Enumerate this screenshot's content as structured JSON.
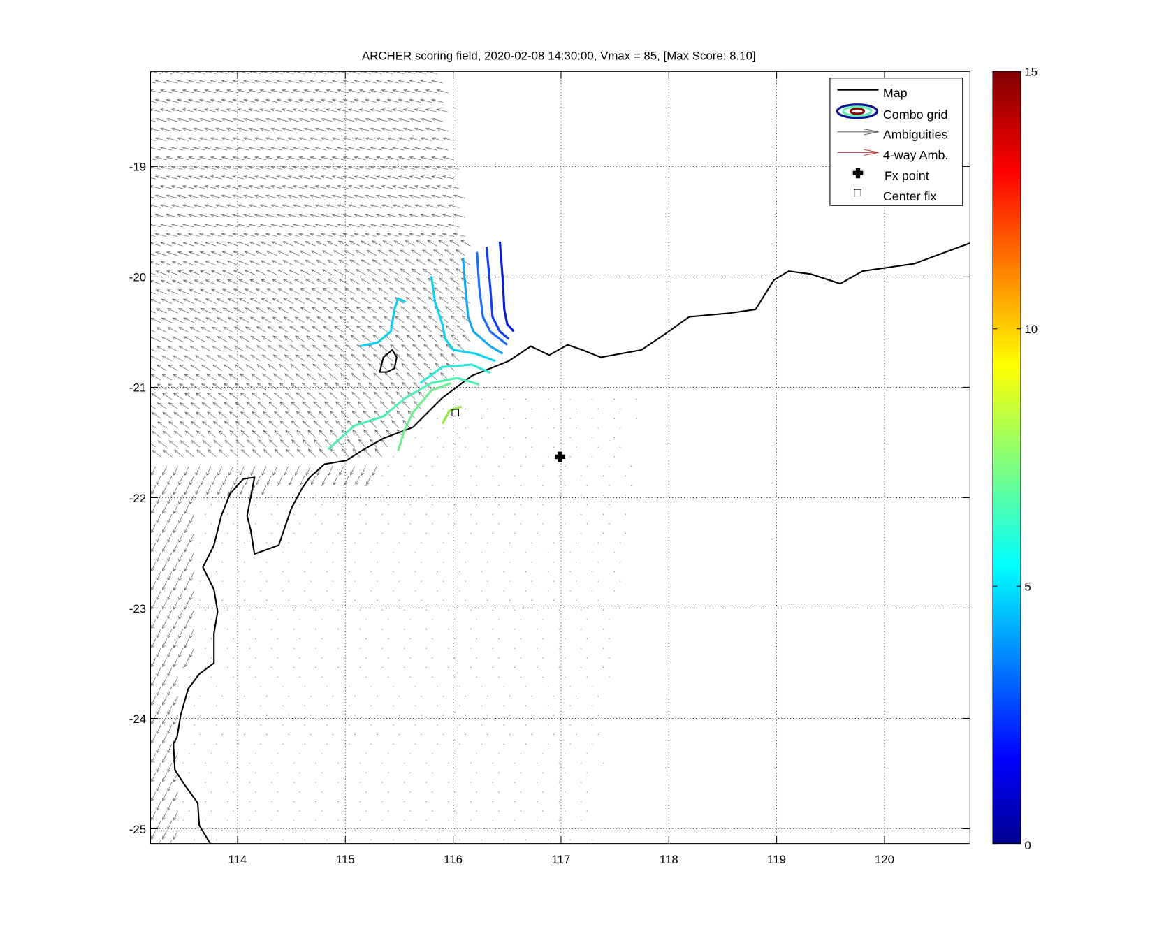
{
  "chart_data": {
    "type": "map",
    "title": "ARCHER scoring field, 2020-02-08 14:30:00, Vmax = 85, [Max Score: 8.10]",
    "xlabel": "",
    "ylabel": "",
    "xlim": [
      113.2,
      120.8
    ],
    "ylim": [
      -25.13,
      -18.13
    ],
    "xticks": [
      "114",
      "115",
      "116",
      "117",
      "118",
      "119",
      "120"
    ],
    "xtick_values": [
      114,
      115,
      116,
      117,
      118,
      119,
      120
    ],
    "yticks": [
      "-19",
      "-20",
      "-21",
      "-22",
      "-23",
      "-24",
      "-25"
    ],
    "ytick_values": [
      -19,
      -20,
      -21,
      -22,
      -23,
      -24,
      -25
    ],
    "grid": true,
    "legend": {
      "placement": "top-right",
      "entries": [
        "Map",
        "Combo grid",
        "Ambiguities",
        "4-way Amb.",
        "Fx point",
        "Center fix"
      ]
    },
    "colorbar": {
      "range": [
        0,
        15
      ],
      "ticks": [
        "0",
        "5",
        "10",
        "15"
      ],
      "tick_values": [
        0,
        5,
        10,
        15
      ],
      "colormap": "jet"
    },
    "fx_point": {
      "lon": 116.99,
      "lat": -21.63
    },
    "center_fix": {
      "lon": 116.02,
      "lat": -21.23
    },
    "contour_levels": [
      {
        "level": 2.5,
        "color": "#0a1ed0"
      },
      {
        "level": 3.0,
        "color": "#1040ee"
      },
      {
        "level": 3.5,
        "color": "#1e6cf5"
      },
      {
        "level": 4.2,
        "color": "#18a8f0"
      },
      {
        "level": 5.0,
        "color": "#12d0ee"
      },
      {
        "level": 5.4,
        "color": "#30e8d8"
      },
      {
        "level": 6.0,
        "color": "#50f0b0"
      },
      {
        "level": 6.6,
        "color": "#70f090"
      },
      {
        "level": 7.5,
        "color": "#90e840"
      }
    ],
    "colors": {
      "map": "#000000",
      "ambiguities": "#666666",
      "four_way": "#c04040"
    }
  }
}
